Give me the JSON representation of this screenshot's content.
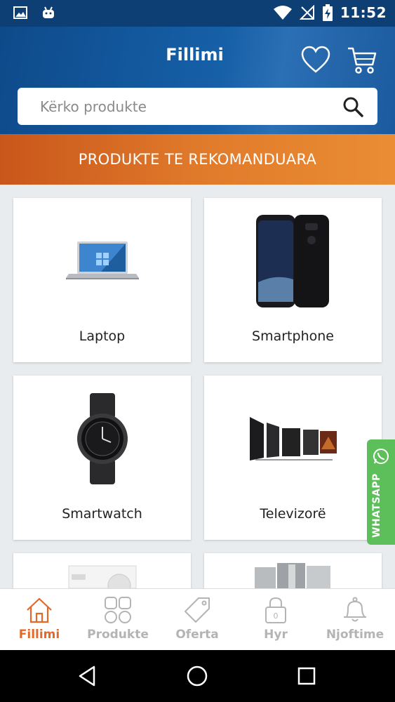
{
  "status_bar": {
    "time": "11:52"
  },
  "header": {
    "title": "Fillimi"
  },
  "search": {
    "placeholder": "Kërko produkte"
  },
  "banner": {
    "text": "PRODUKTE TE REKOMANDUARA"
  },
  "categories": [
    {
      "label": "Laptop"
    },
    {
      "label": "Smartphone"
    },
    {
      "label": "Smartwatch"
    },
    {
      "label": "Televizorë"
    },
    {
      "label": ""
    },
    {
      "label": ""
    }
  ],
  "whatsapp": {
    "label": "WHATSAPP"
  },
  "bottom_nav": [
    {
      "label": "Fillimi",
      "icon": "home-icon",
      "active": true
    },
    {
      "label": "Produkte",
      "icon": "grid-icon",
      "active": false
    },
    {
      "label": "Oferta",
      "icon": "tag-icon",
      "active": false
    },
    {
      "label": "Hyr",
      "icon": "lock-icon",
      "badge": "0",
      "active": false
    },
    {
      "label": "Njoftime",
      "icon": "bell-icon",
      "active": false
    }
  ],
  "colors": {
    "header_blue": "#1660a8",
    "accent_orange": "#e2692a",
    "whatsapp_green": "#5cbf5a"
  }
}
